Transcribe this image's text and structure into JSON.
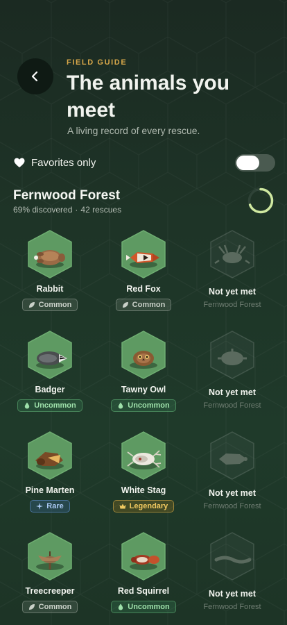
{
  "header": {
    "eyebrow": "FIELD GUIDE",
    "title": "The animals you meet",
    "subtitle": "A living record of every rescue."
  },
  "favorites": {
    "label": "Favorites only",
    "enabled": true
  },
  "region": {
    "name": "Fernwood Forest",
    "discovered": "69% discovered",
    "rescues": "42 rescues",
    "discovered_fraction": 0.69
  },
  "cards": [
    {
      "name": "Rabbit",
      "rarity": "Common",
      "rarity_key": "common",
      "animal": "rabbit",
      "locked": false
    },
    {
      "name": "Red Fox",
      "rarity": "Common",
      "rarity_key": "common",
      "animal": "fox",
      "locked": false
    },
    {
      "name": "Not yet met",
      "region": "Fernwood Forest",
      "animal": "deer-silhouette",
      "locked": true
    },
    {
      "name": "Badger",
      "rarity": "Uncommon",
      "rarity_key": "uncommon",
      "animal": "badger",
      "locked": false
    },
    {
      "name": "Tawny Owl",
      "rarity": "Uncommon",
      "rarity_key": "uncommon",
      "animal": "owl",
      "locked": false
    },
    {
      "name": "Not yet met",
      "region": "Fernwood Forest",
      "animal": "hedgehog-silhouette",
      "locked": true
    },
    {
      "name": "Pine Marten",
      "rarity": "Rare",
      "rarity_key": "rare",
      "animal": "pine-marten",
      "locked": false
    },
    {
      "name": "White Stag",
      "rarity": "Legendary",
      "rarity_key": "legendary",
      "animal": "white-stag",
      "locked": false
    },
    {
      "name": "Not yet met",
      "region": "Fernwood Forest",
      "animal": "boar-silhouette",
      "locked": true
    },
    {
      "name": "Treecreeper",
      "rarity": "Common",
      "rarity_key": "common",
      "animal": "treecreeper",
      "locked": false
    },
    {
      "name": "Red Squirrel",
      "rarity": "Uncommon",
      "rarity_key": "uncommon",
      "animal": "squirrel",
      "locked": false
    },
    {
      "name": "Not yet met",
      "region": "Fernwood Forest",
      "animal": "snake-silhouette",
      "locked": true
    }
  ],
  "colors": {
    "accent_gold": "#d9a84a",
    "hex_fill": "#5e9a62",
    "ring": "#cfe8a0"
  }
}
